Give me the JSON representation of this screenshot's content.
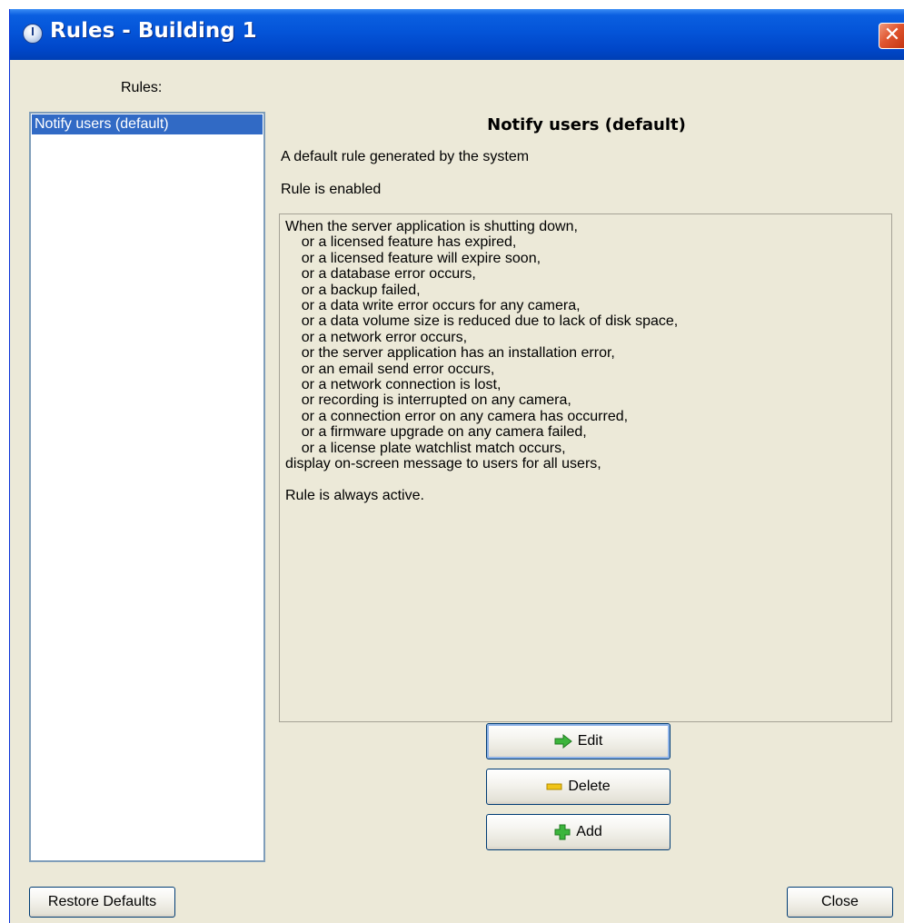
{
  "window": {
    "title": "Rules - Building 1",
    "close_glyph": "✕"
  },
  "sidebar": {
    "label": "Rules:",
    "items": [
      {
        "label": "Notify users (default)",
        "selected": true
      }
    ]
  },
  "detail": {
    "heading": "Notify users (default)",
    "description": "A default rule generated by the system",
    "status": "Rule is enabled",
    "rule_text": "When the server application is shutting down,\n    or a licensed feature has expired,\n    or a licensed feature will expire soon,\n    or a database error occurs,\n    or a backup failed,\n    or a data write error occurs for any camera,\n    or a data volume size is reduced due to lack of disk space,\n    or a network error occurs,\n    or the server application has an installation error,\n    or an email send error occurs,\n    or a network connection is lost,\n    or recording is interrupted on any camera,\n    or a connection error on any camera has occurred,\n    or a firmware upgrade on any camera failed,\n    or a license plate watchlist match occurs,\ndisplay on-screen message to users for all users,\n\nRule is always active."
  },
  "actions": {
    "edit_label": "Edit",
    "delete_label": "Delete",
    "add_label": "Add",
    "edit_icon": "arrow-right-icon",
    "delete_icon": "minus-icon",
    "add_icon": "plus-icon"
  },
  "footer": {
    "restore_label": "Restore Defaults",
    "close_label": "Close"
  },
  "colors": {
    "titlebar": "#0454d8",
    "selection": "#316ac5",
    "window_bg": "#ece9d8",
    "edit_icon": "#3cb53c",
    "delete_icon": "#f0c419",
    "add_icon": "#3cb53c"
  }
}
